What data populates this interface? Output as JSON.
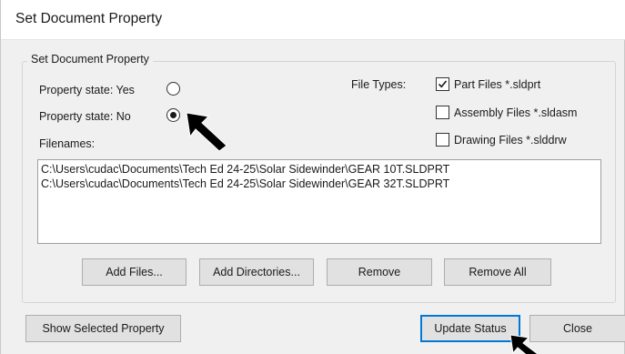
{
  "window": {
    "title": "Set Document Property"
  },
  "group": {
    "title": "Set Document Property",
    "property_state_yes": "Property state: Yes",
    "property_state_no": "Property state: No",
    "selected_state": "No",
    "file_types_label": "File Types:",
    "file_types": [
      {
        "label": "Part Files *.sldprt",
        "checked": true
      },
      {
        "label": "Assembly Files *.sldasm",
        "checked": false
      },
      {
        "label": "Drawing Files *.slddrw",
        "checked": false
      }
    ],
    "filenames_label": "Filenames:",
    "filenames": [
      "C:\\Users\\cudac\\Documents\\Tech Ed 24-25\\Solar Sidewinder\\GEAR 10T.SLDPRT",
      "C:\\Users\\cudac\\Documents\\Tech Ed 24-25\\Solar Sidewinder\\GEAR 32T.SLDPRT"
    ],
    "buttons": {
      "add_files": "Add Files...",
      "add_directories": "Add Directories...",
      "remove": "Remove",
      "remove_all": "Remove All"
    }
  },
  "footer": {
    "show_selected_property": "Show Selected Property",
    "update_status": "Update Status",
    "close": "Close"
  },
  "colors": {
    "default_button_border": "#0078d7",
    "window_bg": "#f0f0f0"
  },
  "icons": [
    "radio-unchecked",
    "radio-checked",
    "checkbox-checked",
    "checkbox-unchecked",
    "mouse-pointer-arrow"
  ]
}
